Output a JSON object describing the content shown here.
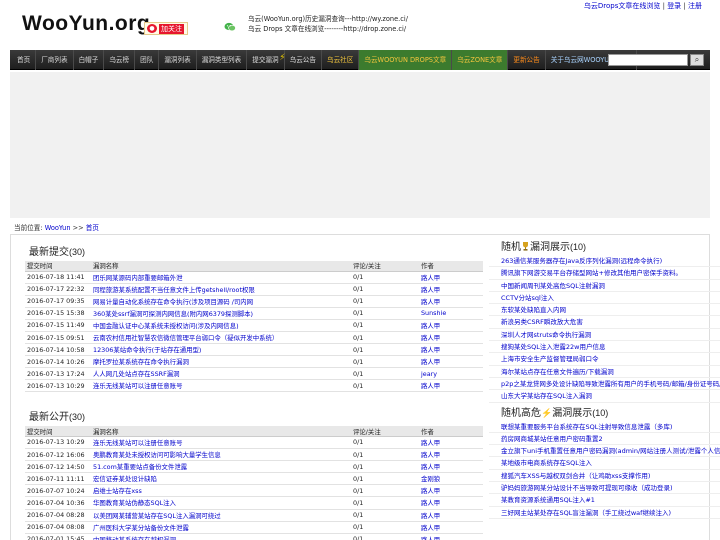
{
  "toplinks": {
    "drops_link": "乌云Drops文章在线浏览",
    "sep1": " | ",
    "login": "登录",
    "sep2": " | ",
    "register": "注册"
  },
  "header": {
    "logo": "WooYun.org",
    "weibo_label": "加关注",
    "line1_prefix": "乌云(WooYun.org)历史漏洞查询---",
    "line1_link": "http://wy.zone.ci/",
    "line2_prefix": "乌云 Drops 文章在线浏览--------",
    "line2_link": "http://drop.zone.ci/"
  },
  "nav": {
    "items": [
      "首页",
      "厂商列表",
      "白帽子",
      "乌云榜",
      "团队",
      "漏洞列表",
      "漏洞类型列表",
      "提交漏洞",
      "乌云公告",
      "乌云社区",
      "乌云WOOYUN DROPS文章",
      "乌云ZONE文章",
      "更新公告",
      "关于乌云网WOOYUN.ORG"
    ],
    "search_placeholder": "",
    "search_icon": "search-icon"
  },
  "breadcrumb": {
    "prefix": "当前位置: ",
    "link1": "WooYun",
    "sep": " >> ",
    "link2": "首页"
  },
  "recent_submit": {
    "title": "最新提交",
    "count": "(30)",
    "headers": [
      "提交时间",
      "漏洞名称",
      "评论/关注",
      "作者"
    ],
    "rows": [
      [
        "2016-07-18 11:41",
        "团乐网某源码内部重要邮箱外泄",
        "0/1",
        "路人甲"
      ],
      [
        "2016-07-17 22:32",
        "同程旅游某系统配置不当任意文件上传getshell/root权限",
        "0/1",
        "路人甲"
      ],
      [
        "2016-07-17 09:35",
        "网易计量自动化系统存在命令执行(涉及项目源码 /司内网",
        "0/1",
        "路人甲"
      ],
      [
        "2016-07-15 15:38",
        "360某处ssrf漏洞可探测内网信息(附内网6379探测脚本)",
        "0/1",
        "Sunshie"
      ],
      [
        "2016-07-15 11:49",
        "中国金融认证中心某系统未授权访问(涉及内网信息)",
        "0/1",
        "路人甲"
      ],
      [
        "2016-07-15 09:51",
        "云南农村信用社智慧农信微信管理平台弱口令（疑似开发中系统）",
        "0/1",
        "路人甲"
      ],
      [
        "2016-07-14 10:58",
        "12306某站命令执行(于站存在通用型)",
        "0/1",
        "路人甲"
      ],
      [
        "2016-07-14 10:26",
        "摩托罗拉某系统存在命令执行漏洞",
        "0/1",
        "路人甲"
      ],
      [
        "2016-07-13 17:24",
        "人人网几处站点存在SSRF漏洞",
        "0/1",
        "jeary"
      ],
      [
        "2016-07-13 10:29",
        "连乐无线某站可以注册任意账号",
        "0/1",
        "路人甲"
      ]
    ]
  },
  "recent_public": {
    "title": "最新公开",
    "count": "(30)",
    "headers": [
      "提交时间",
      "漏洞名称",
      "评论/关注",
      "作者"
    ],
    "rows": [
      [
        "2016-07-13 10:29",
        "连乐无线某站可以注册任意账号",
        "0/1",
        "路人甲"
      ],
      [
        "2016-07-12 16:06",
        "奥鹏教育某处未授权访问可影响大量学生信息",
        "0/1",
        "路人甲"
      ],
      [
        "2016-07-12 14:50",
        "51.com某重要站点备份文件泄露",
        "0/1",
        "路人甲"
      ],
      [
        "2016-07-11 11:11",
        "宏信证券某处设计缺陷",
        "0/1",
        "金刚狼"
      ],
      [
        "2016-07-07 10:24",
        "启维士站存在xss",
        "0/1",
        "路人甲"
      ],
      [
        "2016-07-04 10:36",
        "华图教育某站伪静态SQL注入",
        "0/1",
        "路人甲"
      ],
      [
        "2016-07-04 08:28",
        "以美团网某辅营某站存在SQL注入漏洞可绕过",
        "0/1",
        "路人甲"
      ],
      [
        "2016-07-04 08:08",
        "广州医科大学某分站备份文件泄露",
        "0/1",
        "路人甲"
      ],
      [
        "2016-07-01 15:45",
        "中国移动某系统存在越权漏洞",
        "0/1",
        "路人甲"
      ]
    ]
  },
  "random_vuln": {
    "title_a": "随机",
    "title_b": "漏洞展示",
    "count": "(10)",
    "items": [
      "263通信某服务器存在Java反序列化漏洞(远程命令执行)",
      "腾讯旗下网游交易平台存储型网站+修改其他用户密保手资料。",
      "中国新闻周刊某处高危SQL注射漏洞",
      "CCTV分站sql注入",
      "东软某处缺陷直入内网",
      "新浪另类CSRF瞬改放大危害",
      "深圳人才网struts命令执行漏洞",
      "搜狗某处SQL注入泄露22w用户信息",
      "上海市安全生产监督管理局弱口令",
      "海尔某站点存在任意文件遍历/下载漏洞",
      "p2p之某龙贷网多处设计缺陷导致泄露所有用户的手机号码/邮箱/身份证号码/姓名/隐私信息/银行卡号",
      "山东大学某站存在SQL注入漏洞"
    ]
  },
  "random_high": {
    "title_a": "随机高危",
    "title_b": "漏洞展示",
    "count": "(10)",
    "items": [
      "联想某重要服务平台系统存在SQL注射导致信息泄露（多库)",
      "药房网商城某站任意用户密码重置2",
      "金立旗下uni手机重置任意用户密码漏洞(admin/网站注册人测试/泄露个人信息/危害)",
      "某地级市电商系统存在SQL注入",
      "搜狐汽车XSS与越权双剑合并（让鸡助xss支撑作用)",
      "驴妈妈旅游网某分站设计不当导致可提现可缘收（成功登录)",
      "某教育资源系统通用SQL注入#1",
      "三好网主站某处存在SQL盲注漏洞（手工绕过waf继续注入)"
    ]
  }
}
